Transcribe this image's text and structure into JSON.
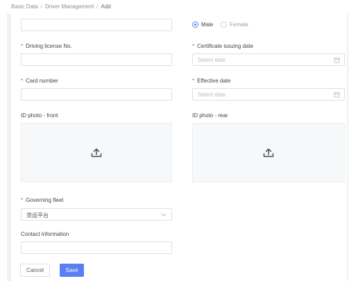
{
  "breadcrumb": {
    "items": [
      "Basic Data",
      "Driver Management",
      "Add"
    ],
    "separator": "/"
  },
  "gender": {
    "options": [
      "Male",
      "Female"
    ],
    "selected": "Male"
  },
  "fields": {
    "driving_license": {
      "label": "Driving license No.",
      "value": ""
    },
    "card_number": {
      "label": "Card number",
      "value": ""
    },
    "cert_issuing_date": {
      "label": "Certificate issuing date",
      "placeholder": "Select date"
    },
    "effective_date": {
      "label": "Effective date",
      "placeholder": "Select date"
    },
    "governing_fleet": {
      "label": "Governing fleet",
      "value": "货运平台"
    },
    "contact_information": {
      "label": "Contact information",
      "value": ""
    }
  },
  "uploads": {
    "front_label": "ID photo - front",
    "rear_label": "ID photo - rear"
  },
  "icons": {
    "upload": "upload-icon",
    "calendar": "calendar-icon",
    "chevron": "chevron-down-icon"
  },
  "buttons": {
    "cancel": "Cancel",
    "save": "Save"
  },
  "colors": {
    "primary": "#5b7ff2",
    "required": "#e34d4d",
    "border": "#dcdfe6",
    "upload_bg": "#f7f8fa"
  }
}
